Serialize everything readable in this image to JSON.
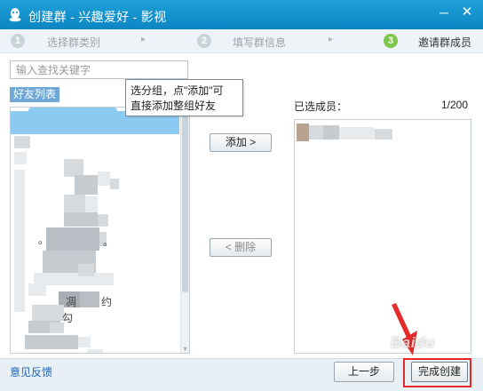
{
  "window": {
    "title": "创建群 - 兴趣爱好 - 影视",
    "minimize_glyph": "─",
    "close_glyph": "✕"
  },
  "steps": [
    {
      "num": "1",
      "label": "选择群类别"
    },
    {
      "num": "2",
      "label": "填写群信息"
    },
    {
      "num": "3",
      "label": "邀请群成员"
    }
  ],
  "step_arrow": "▸",
  "search": {
    "placeholder": "输入查找关键字",
    "value": ""
  },
  "friends": {
    "tab_label": "好友列表",
    "stray_chars": [
      "。",
      "。",
      "凋",
      "约",
      "勾"
    ]
  },
  "tooltip": {
    "line1": "选分组，点\"添加\"可",
    "line2": "直接添加整组好友"
  },
  "buttons": {
    "add": "添加 >",
    "delete": "< 删除",
    "prev": "上一步",
    "finish": "完成创建"
  },
  "selected": {
    "label": "已选成员：",
    "count": "1/200"
  },
  "bottom": {
    "feedback": "意见反馈"
  },
  "watermark": "Baidu",
  "colors": {
    "titlebar": "#1496d2",
    "step_active": "#7dc64a",
    "highlight_row": "#8ccaf2",
    "annotation_red": "#e52a2a",
    "link": "#1a62b8"
  },
  "icons": {
    "app": "qq-penguin-icon",
    "scroll": "scroll-down-icon"
  }
}
